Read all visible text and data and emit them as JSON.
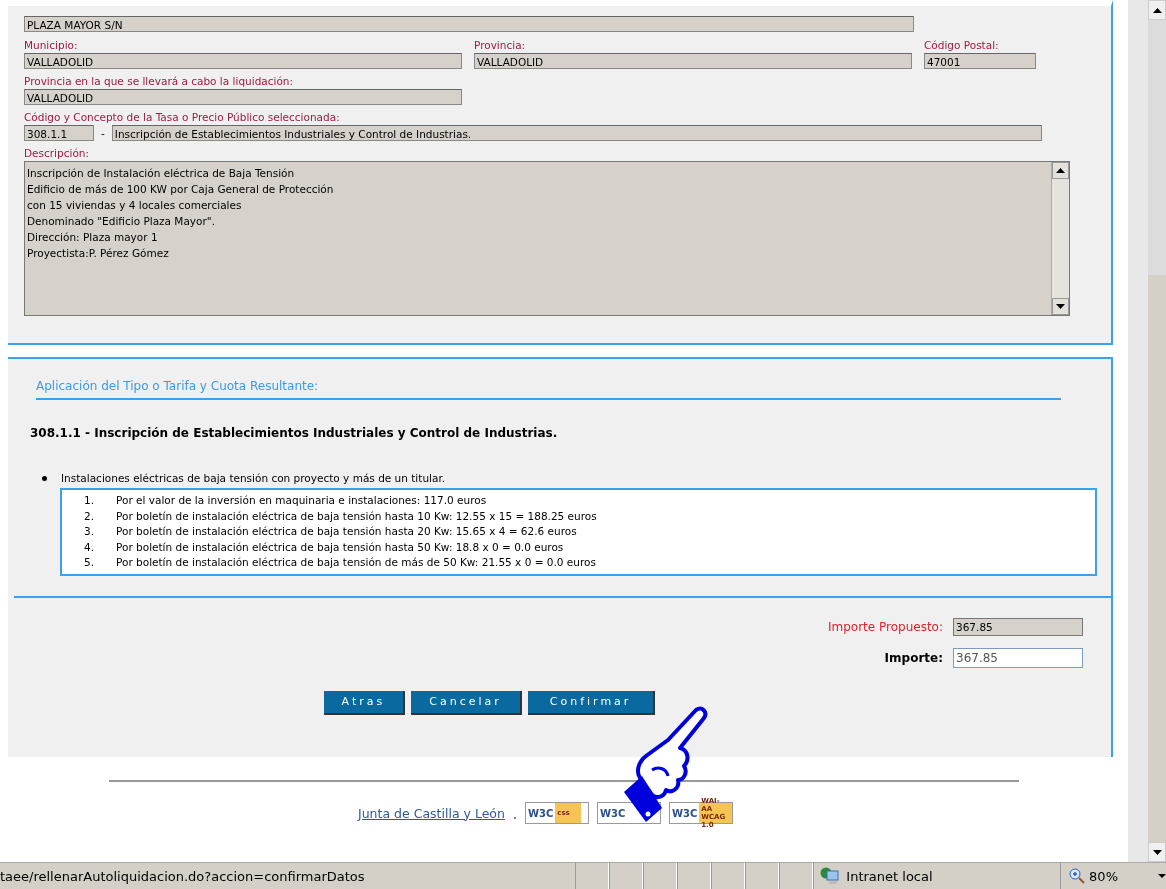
{
  "address": {
    "value": "PLAZA MAYOR S/N"
  },
  "location_fields": [
    {
      "label": "Municipio:",
      "value": "VALLADOLID",
      "kind": "wide"
    },
    {
      "label": "Provincia:",
      "value": "VALLADOLID",
      "kind": "wide"
    },
    {
      "label": "Código Postal:",
      "value": "47001",
      "kind": "narrow"
    }
  ],
  "settlement_province": {
    "label": "Provincia en la que se llevará a cabo la liquidación:",
    "value": "VALLADOLID"
  },
  "fee": {
    "label": "Código y Concepto de la Tasa o Precio Público seleccionada:",
    "code": "308.1.1",
    "separator": "-",
    "concept": "Inscripción de Establecimientos Industriales y Control de Industrias."
  },
  "description": {
    "label": "Descripción:",
    "lines": [
      "Inscripción de Instalación eléctrica de Baja Tensión",
      "Edificio de más de 100 KW por Caja General de Protección",
      "con 15 viviendas y 4 locales comerciales",
      "Denominado \"Edificio Plaza Mayor\".",
      "Dirección: Plaza mayor 1",
      "Proyectista:P. Pérez Gómez"
    ]
  },
  "rate_section": {
    "title": "Aplicación del Tipo o Tarifa y Cuota Resultante:",
    "heading": "308.1.1 - Inscripción de Establecimientos Industriales y Control de Industrias.",
    "bullet": "Instalaciones eléctricas de baja tensión con proyecto y más de un titular.",
    "items": [
      {
        "number": "1.",
        "text": "Por el valor de la inversión en maquinaria e instalaciones: 117.0 euros"
      },
      {
        "number": "2.",
        "text": "Por boletín de instalación eléctrica de baja tensión hasta 10 Kw: 12.55 x 15 = 188.25 euros"
      },
      {
        "number": "3.",
        "text": "Por boletín de instalación eléctrica de baja tensión hasta 20 Kw: 15.65 x 4 = 62.6 euros"
      },
      {
        "number": "4.",
        "text": "Por boletín de instalación eléctrica de baja tensión hasta 50 Kw: 18.8 x 0 = 0.0 euros"
      },
      {
        "number": "5.",
        "text": "Por boletín de instalación eléctrica de baja tensión de más de 50 Kw: 21.55 x 0 = 0.0 euros"
      }
    ]
  },
  "amounts": [
    {
      "label": "Importe Propuesto:",
      "value": "367.85",
      "kind": "readonly"
    },
    {
      "label": "Importe:",
      "value": "367.85",
      "kind": "editable"
    }
  ],
  "buttons": [
    "Atras",
    "Cancelar",
    "Confirmar"
  ],
  "footer": {
    "link": "Junta de Castilla y León",
    "separator": ".",
    "badges": [
      {
        "logo": "W3C",
        "text": "css"
      },
      {
        "logo": "W3C"
      },
      {
        "logo": "W3C",
        "text": "WAI-AA WCAG 1.0"
      }
    ]
  },
  "status_bar": {
    "url": "taee/rellenarAutoliquidacion.do?accion=confirmarDatos",
    "zone": "Intranet local",
    "zoom": "80%"
  }
}
